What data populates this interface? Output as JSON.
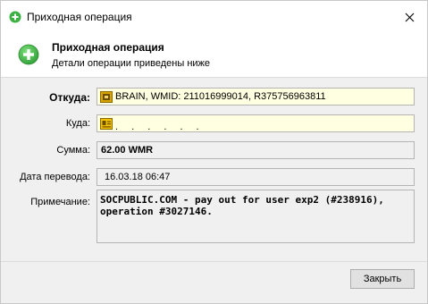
{
  "window": {
    "title": "Приходная операция",
    "close_symbol": "✕"
  },
  "header": {
    "title": "Приходная операция",
    "subtitle": "Детали операции приведены ниже",
    "icon": "green-plus-icon"
  },
  "form": {
    "from_label": "Откуда:",
    "from_value": "BRAIN, WMID: 211016999014, R375756963811",
    "to_label": "Куда:",
    "to_value": ". . . . . .",
    "amount_label": "Сумма:",
    "amount_value": "62.00 WMR",
    "date_label": "Дата перевода:",
    "date_value": "16.03.18 06:47",
    "note_label": "Примечание:",
    "note_value": "SOCPUBLIC.COM - pay out for user exp2 (#238916), operation #3027146."
  },
  "footer": {
    "close_label": "Закрыть"
  },
  "colors": {
    "accent_green": "#3cb043",
    "field_yellow": "#ffffe1",
    "window_bg": "#f0f0f0"
  }
}
